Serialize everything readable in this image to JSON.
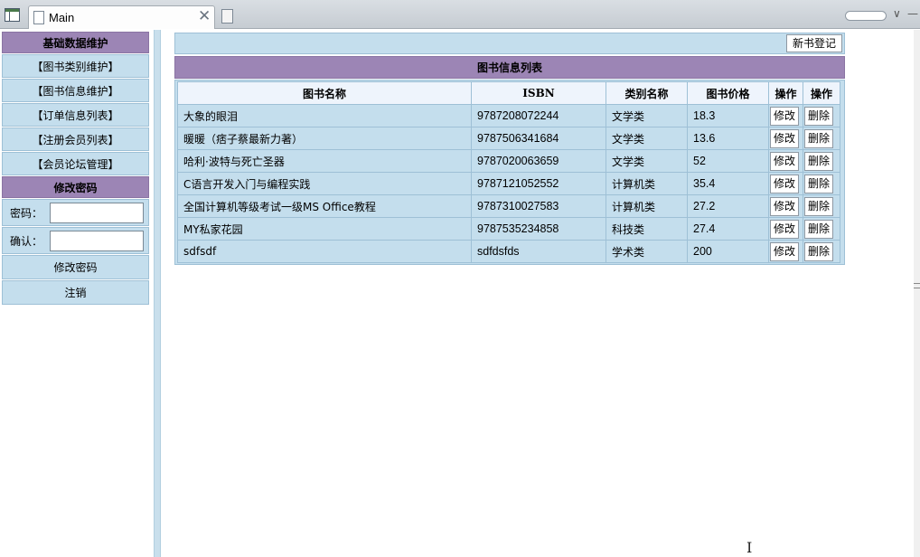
{
  "browser": {
    "tab_title": "Main",
    "close_symbol": "✕"
  },
  "sidebar": {
    "basic_header": "基础数据维护",
    "items": [
      {
        "label": "【图书类别维护】"
      },
      {
        "label": "【图书信息维护】"
      },
      {
        "label": "【订单信息列表】"
      },
      {
        "label": "【注册会员列表】"
      },
      {
        "label": "【会员论坛管理】"
      }
    ],
    "password_header": "修改密码",
    "password_label": "密码：",
    "password_value": "",
    "confirm_label": "确认：",
    "confirm_value": "",
    "change_password_button": "修改密码",
    "logout_button": "注销"
  },
  "main": {
    "new_book_button": "新书登记",
    "list_title": "图书信息列表",
    "columns": [
      "图书名称",
      "ISBN",
      "类别名称",
      "图书价格",
      "操作",
      "操作"
    ],
    "edit_label": "修改",
    "delete_label": "删除",
    "rows": [
      {
        "name": "大象的眼泪",
        "isbn": "9787208072244",
        "category": "文学类",
        "price": "18.3"
      },
      {
        "name": "暖暖（痞子蔡最新力著）",
        "isbn": "9787506341684",
        "category": "文学类",
        "price": "13.6"
      },
      {
        "name": "哈利·波特与死亡圣器",
        "isbn": "9787020063659",
        "category": "文学类",
        "price": "52"
      },
      {
        "name": "C语言开发入门与编程实践",
        "isbn": "9787121052552",
        "category": "计算机类",
        "price": "35.4"
      },
      {
        "name": "全国计算机等级考试一级MS Office教程",
        "isbn": "9787310027583",
        "category": "计算机类",
        "price": "27.2"
      },
      {
        "name": "MY私家花园",
        "isbn": "9787535234858",
        "category": "科技类",
        "price": "27.4"
      },
      {
        "name": "sdfsdf",
        "isbn": "sdfdsfds",
        "category": "学术类",
        "price": "200"
      }
    ]
  },
  "icons": {
    "app": "window-icon",
    "page": "page-icon",
    "new_tab": "new-tab-icon",
    "dropdown": "chevron-down-icon",
    "minimize": "minimize-icon"
  },
  "colors": {
    "header_purple": "#9c85b5",
    "cell_blue": "#c4deed",
    "header_row": "#eef4fc"
  }
}
